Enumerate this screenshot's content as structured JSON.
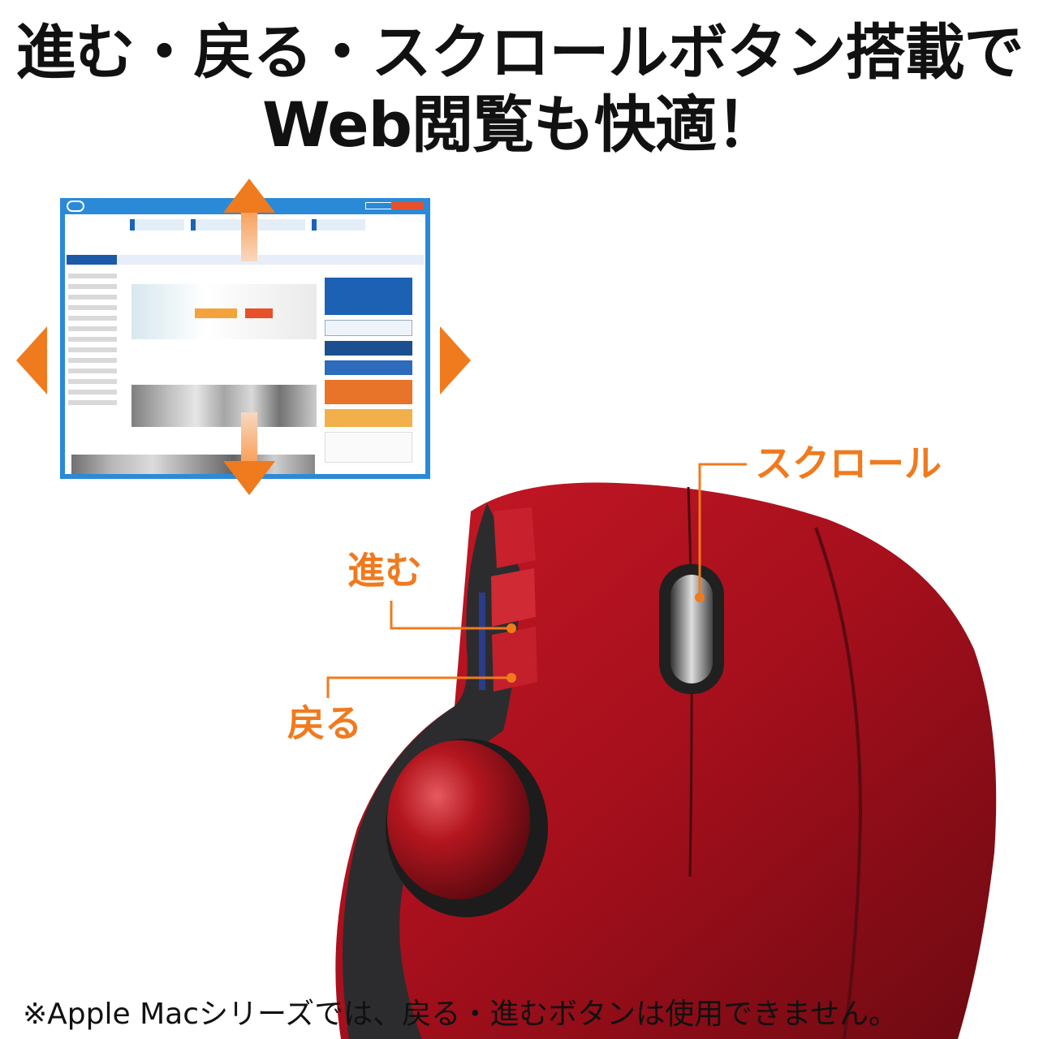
{
  "headline": {
    "line1": "進む・戻る・スクロールボタン搭載で",
    "line2": "Web閲覧も快適！"
  },
  "labels": {
    "scroll": "スクロール",
    "forward": "進む",
    "back": "戻る"
  },
  "footnote": "※Apple Macシリーズでは、戻る・進むボタンは使用できません。",
  "colors": {
    "accent": "#f07a1e",
    "browser_frame": "#2a8ad8",
    "mouse_red": "#b3121f"
  }
}
